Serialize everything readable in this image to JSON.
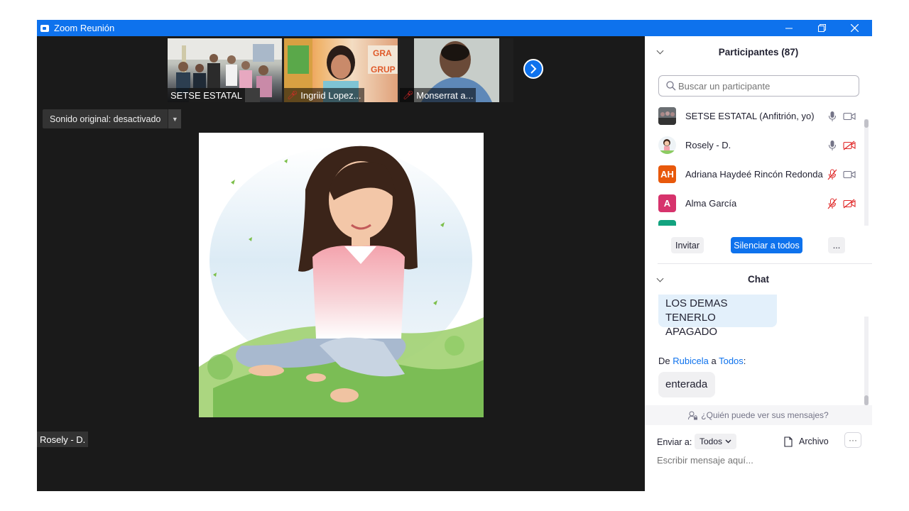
{
  "window": {
    "title": "Zoom Reunión"
  },
  "thumbnails": [
    {
      "name": "SETSE ESTATAL",
      "muted": false
    },
    {
      "name": "Ingriid Lopez...",
      "muted": true
    },
    {
      "name": "Monserrat a...",
      "muted": true
    }
  ],
  "sound_button": {
    "label": "Sonido original: desactivado"
  },
  "active_speaker": {
    "name": "Rosely - D."
  },
  "participants_panel": {
    "title": "Participantes (87)",
    "search_placeholder": "Buscar un participante",
    "participants": [
      {
        "name": "SETSE ESTATAL (Anfitrión, yo)",
        "avatar": "",
        "mic": "on",
        "video": "on"
      },
      {
        "name": "Rosely - D.",
        "avatar": "",
        "mic": "on",
        "video": "off"
      },
      {
        "name": "Adriana Haydeé Rincón Redonda",
        "avatar": "AH",
        "avatar_color": "#e8590c",
        "mic": "off",
        "video": "on"
      },
      {
        "name": "Alma García",
        "avatar": "A",
        "avatar_color": "#d6336c",
        "mic": "off",
        "video": "off"
      }
    ],
    "buttons": {
      "invite": "Invitar",
      "mute_all": "Silenciar a todos",
      "more": "..."
    }
  },
  "chat": {
    "title": "Chat",
    "messages": [
      {
        "text_line1": "LOS DEMAS TENERLO",
        "text_line2": "APAGADO"
      },
      {
        "from_prefix": "De",
        "sender": "Rubicela",
        "to_word": "a",
        "recipient": "Todos",
        "text": "enterada"
      }
    ],
    "who_can_see": "¿Quién puede ver sus mensajes?",
    "send_to_label": "Enviar a:",
    "send_to_value": "Todos",
    "file_label": "Archivo",
    "input_placeholder": "Escribir mensaje aquí..."
  },
  "colors": {
    "accent": "#0e72ed",
    "muted_red": "#e02828"
  }
}
